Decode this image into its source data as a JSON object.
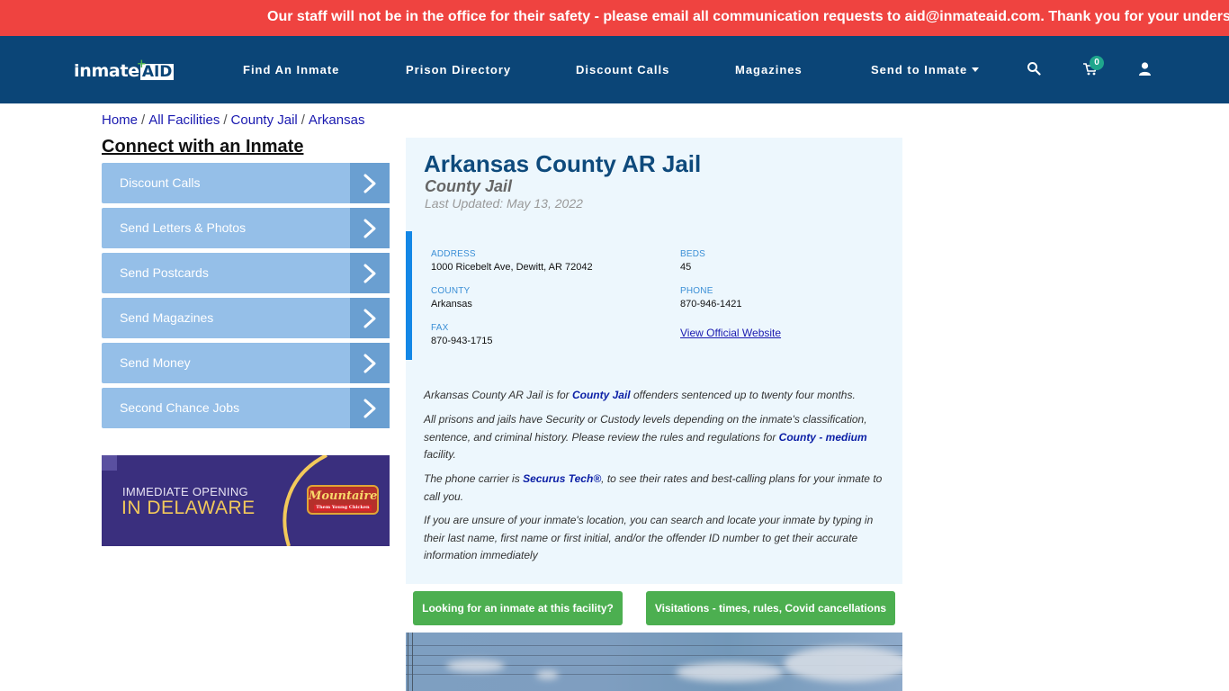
{
  "announcement": "Our staff will not be in the office for their safety - please email all communication requests to aid@inmateaid.com. Thank you for your understanding.",
  "colors": {
    "announcement_bg": "#ef4340",
    "navbar_bg": "#0b4577",
    "side_button_bg": "#95bfe8",
    "side_button_arrow_bg": "#6a9fd1",
    "main_panel_bg": "#edf7fd",
    "info_accent": "#1387e6",
    "green_button": "#4caf50",
    "title": "#0e4a7c"
  },
  "nav": {
    "logo": {
      "text": "inmate",
      "accent": "AID",
      "icon": "plus-icon"
    },
    "items": [
      {
        "label": "Find An Inmate"
      },
      {
        "label": "Prison Directory"
      },
      {
        "label": "Discount Calls"
      },
      {
        "label": "Magazines"
      },
      {
        "label": "Send to Inmate",
        "dropdown": true
      }
    ],
    "icons": {
      "search": "search-icon",
      "cart": "cart-icon",
      "user": "user-icon"
    },
    "cart_count": "0"
  },
  "breadcrumb": [
    "Home",
    "All Facilities",
    "County Jail",
    "Arkansas"
  ],
  "sidebar": {
    "title": "Connect with an Inmate",
    "items": [
      {
        "label": "Discount Calls"
      },
      {
        "label": "Send Letters & Photos"
      },
      {
        "label": "Send Postcards"
      },
      {
        "label": "Send Magazines"
      },
      {
        "label": "Send Money"
      },
      {
        "label": "Second Chance Jobs"
      }
    ],
    "ad": {
      "line1": "IMMEDIATE OPENING",
      "line2": "IN DELAWARE",
      "brand": "Mountaire",
      "brand_tagline": "Them Young Chicken"
    }
  },
  "facility": {
    "name": "Arkansas County AR Jail",
    "type": "County Jail",
    "last_updated": "Last Updated: May 13, 2022",
    "info": {
      "address_label": "ADDRESS",
      "address": "1000 Ricebelt Ave, Dewitt, AR 72042",
      "beds_label": "BEDS",
      "beds": "45",
      "county_label": "COUNTY",
      "county": "Arkansas",
      "phone_label": "PHONE",
      "phone": "870-946-1421",
      "fax_label": "FAX",
      "fax": "870-943-1715",
      "website_link": "View Official Website"
    },
    "paragraphs": {
      "p1_pre": "Arkansas County AR Jail is for ",
      "p1_link": "County Jail",
      "p1_post": " offenders sentenced up to twenty four months.",
      "p2_pre": "All prisons and jails have Security or Custody levels depending on the inmate's classification, sentence, and criminal history. Please review the rules and regulations for ",
      "p2_link": "County - medium",
      "p2_post": " facility.",
      "p3_pre": "The phone carrier is ",
      "p3_link": "Securus Tech®",
      "p3_post": ", to see their rates and best-calling plans for your inmate to call you.",
      "p4": "If you are unsure of your inmate's location, you can search and locate your inmate by typing in their last name, first name or first initial, and/or the offender ID number to get their accurate information immediately"
    },
    "buttons": {
      "find_inmate": "Looking for an inmate at this facility?",
      "visitations": "Visitations - times, rules, Covid cancellations"
    }
  }
}
